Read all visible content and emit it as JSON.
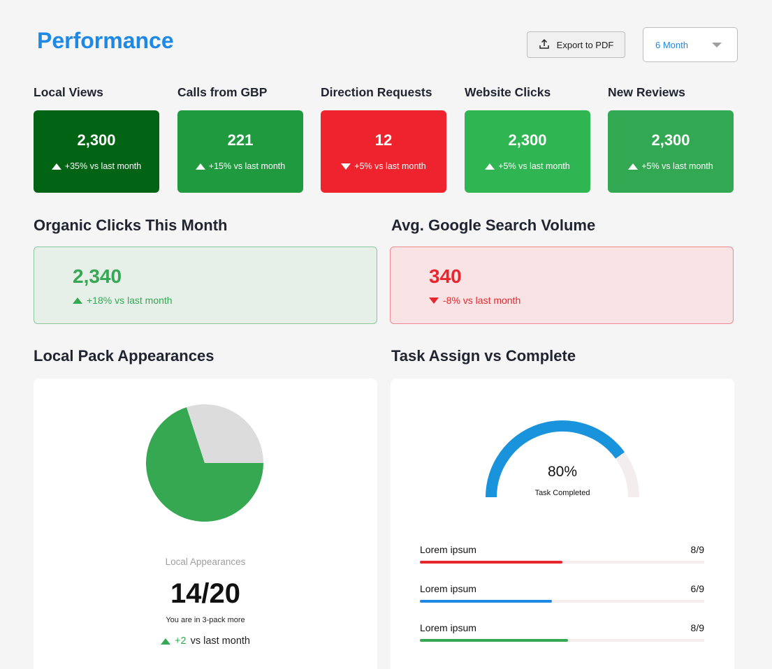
{
  "header": {
    "title": "Performance",
    "export_label": "Export to PDF",
    "period": "6 Month"
  },
  "kpis": [
    {
      "label": "Local Views",
      "value": "2,300",
      "change": "+35% vs last month",
      "direction": "up",
      "color": "#006414"
    },
    {
      "label": "Calls from GBP",
      "value": "221",
      "change": "+15% vs last month",
      "direction": "up",
      "color": "#1f9a3f"
    },
    {
      "label": "Direction Requests",
      "value": "12",
      "change": "+5% vs last month",
      "direction": "down",
      "color": "#ef232d"
    },
    {
      "label": "Website Clicks",
      "value": "2,300",
      "change": "+5% vs last month",
      "direction": "up",
      "color": "#2fb552"
    },
    {
      "label": "New Reviews",
      "value": "2,300",
      "change": "+5% vs last month",
      "direction": "up",
      "color": "#32a852"
    }
  ],
  "organic": {
    "title": "Organic Clicks This Month",
    "value": "2,340",
    "change": "+18% vs last month"
  },
  "search_volume": {
    "title": "Avg. Google Search Volume",
    "value": "340",
    "change": "-8% vs last month"
  },
  "local_pack": {
    "title": "Local Pack Appearances",
    "label": "Local Appearances",
    "value": "14/20",
    "subtitle": "You are in 3-pack more",
    "delta": "+2",
    "delta_suffix": "vs last month"
  },
  "tasks": {
    "title": "Task Assign vs Complete",
    "percent_label": "80%",
    "percent": 80,
    "subtitle": "Task Completed",
    "rows": [
      {
        "label": "Lorem ipsum",
        "value": "8/9",
        "fill": 0.5,
        "color": "#e8262d"
      },
      {
        "label": "Lorem ipsum",
        "value": "6/9",
        "fill": 0.465,
        "color": "#1e88e5"
      },
      {
        "label": "Lorem ipsum",
        "value": "8/9",
        "fill": 0.52,
        "color": "#34a853"
      }
    ]
  },
  "chart_data": {
    "type": "pie",
    "labels": [
      "",
      ""
    ],
    "values": [
      70,
      30
    ],
    "colors": [
      "#36a852",
      "#dcdcdc"
    ]
  }
}
